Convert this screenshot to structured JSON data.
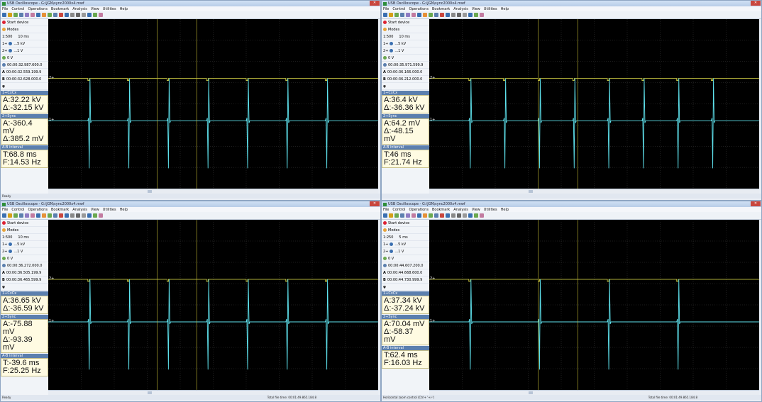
{
  "windows": [
    {
      "title": "USB Oscilloscope - G:\\JGN\\sync2000x4.mwf",
      "menu": [
        "File",
        "Control",
        "Operations",
        "Bookmark",
        "Analysis",
        "View",
        "Utilities",
        "Help"
      ],
      "start_device": "Start device",
      "modes": "Modes",
      "timebase": "1:500",
      "time_div": "10 ms",
      "ch1": "1+",
      "ch1_volt": "...5 kV",
      "ch2": "2+",
      "ch2_volt": "...1 V",
      "trigger": "0 V",
      "time_main": "00:00:32.987.600.0",
      "time_a": "00:00:32.559.199.9",
      "time_b": "00:00:32.628.000.0",
      "cursor1_header": "1+CxCx",
      "cursor1_a": "A:32.22 kV",
      "cursor1_d": "Δ:-32.15 kV",
      "cursor2_header": "2+Sync",
      "cursor2_a": "A:-360.4 mV",
      "cursor2_d": "Δ:385.2 mV",
      "interval_header": "A-B interval",
      "interval_t": "T:68.8 ms",
      "interval_f": "F:14.53 Hz",
      "status_left": "Ready",
      "status_right": ""
    },
    {
      "title": "USB Oscilloscope - G:\\JGN\\sync2000x4.mwf",
      "menu": [
        "File",
        "Control",
        "Operations",
        "Bookmark",
        "Analysis",
        "View",
        "Utilities",
        "Help"
      ],
      "start_device": "Start device",
      "modes": "Modes",
      "timebase": "1:500",
      "time_div": "10 ms",
      "ch1": "1+",
      "ch1_volt": "...5 kV",
      "ch2": "2+",
      "ch2_volt": "...1 V",
      "trigger": "0 V",
      "time_main": "00:00:35.971.599.9",
      "time_a": "00:00:36.166.000.0",
      "time_b": "00:00:36.212.000.0",
      "cursor1_header": "1+CxCx",
      "cursor1_a": "A:36.4 kV",
      "cursor1_d": "Δ:-36.36 kV",
      "cursor2_header": "2+Sync",
      "cursor2_a": "A:64.2 mV",
      "cursor2_d": "Δ:-48.15 mV",
      "interval_header": "A-B interval",
      "interval_t": "T:46 ms",
      "interval_f": "F:21.74 Hz",
      "status_left": "",
      "status_right": ""
    },
    {
      "title": "USB Oscilloscope - G:\\JGN\\sync2000x4.mwf",
      "menu": [
        "File",
        "Control",
        "Operations",
        "Bookmark",
        "Analysis",
        "View",
        "Utilities",
        "Help"
      ],
      "start_device": "Start device",
      "modes": "Modes",
      "timebase": "1:500",
      "time_div": "10 ms",
      "ch1": "1+",
      "ch1_volt": "...5 kV",
      "ch2": "2+",
      "ch2_volt": "...1 V",
      "trigger": "0 V",
      "time_main": "00:00:36.272.000.0",
      "time_a": "00:00:36.505.199.9",
      "time_b": "00:00:36.465.599.9",
      "cursor1_header": "1+CxCx",
      "cursor1_a": "A:36.65 kV",
      "cursor1_d": "Δ:-36.59 kV",
      "cursor2_header": "2+Sync",
      "cursor2_a": "A:-75.88 mV",
      "cursor2_d": "Δ:-93.39 mV",
      "interval_header": "A-B interval",
      "interval_t": "T:-39.6 ms",
      "interval_f": "F:25.25 Hz",
      "status_left": "Ready",
      "status_right": "Total file time: 00:01:49.865.184.8"
    },
    {
      "title": "USB Oscilloscope - G:\\JGN\\sync2000x4.mwf",
      "menu": [
        "File",
        "Control",
        "Operations",
        "Bookmark",
        "Analysis",
        "View",
        "Utilities",
        "Help"
      ],
      "start_device": "Start device",
      "modes": "Modes",
      "timebase": "1:250",
      "time_div": "5 ms",
      "ch1": "1+",
      "ch1_volt": "...5 kV",
      "ch2": "2+",
      "ch2_volt": "...1 V",
      "trigger": "0 V",
      "time_main": "00:00:44.607.200.0",
      "time_a": "00:00:44.668.600.0",
      "time_b": "00:00:44.730.999.9",
      "cursor1_header": "1+CxCx",
      "cursor1_a": "A:37.34 kV",
      "cursor1_d": "Δ:-37.24 kV",
      "cursor2_header": "2+Sync",
      "cursor2_a": "A:70.04 mV",
      "cursor2_d": "Δ:-58.37 mV",
      "interval_header": "A-B interval",
      "interval_t": "T:62.4 ms",
      "interval_f": "F:16.03 Hz",
      "status_left": "Horizontal zoom control (Ctrl+ '+/-')",
      "status_right": "Total file time: 00:01:49.865.184.8"
    }
  ],
  "colors": {
    "trace_ch1": "#5fe3ee",
    "trace_ch2": "#e6e34a",
    "grid": "#3a3a3a",
    "cursor": "#c9c236"
  }
}
